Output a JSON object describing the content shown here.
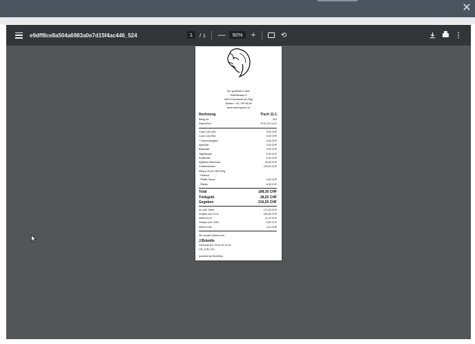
{
  "overlay": {
    "close_icon": "close-icon"
  },
  "toolbar": {
    "title": "e9dff8ce8a504a6983a0e7d15f4ac446_524",
    "page_current": "1",
    "page_separator": "/",
    "page_total": "1",
    "zoom_value": "90%",
    "zoom_out_label": "—",
    "zoom_in_label": "+",
    "icons": [
      "menu-icon",
      "fit-page-icon",
      "rotate-icon",
      "download-icon",
      "print-icon",
      "more-vert-icon"
    ]
  },
  "receipt": {
    "address": [
      "Zur goldenen Löwin",
      "Enfelstrasse 5",
      "6403 Küssnacht am Rigi",
      "Telefon: +41 799 66 60",
      "www.rummywein.ch"
    ],
    "header_left": "Rechnung",
    "header_right": "Tisch 11.1",
    "meta": [
      {
        "label": "Beleg Nr",
        "value": "524"
      },
      {
        "label": "Datum/Zeit",
        "value": "23.01.25 14:31"
      }
    ],
    "items": [
      {
        "label": "Coca Cola 33cl",
        "value": "3,50 CHF"
      },
      {
        "label": "Coca Cola 50cl",
        "value": "4,00 CHF"
      },
      {
        "label": " + Depot Ausgabe",
        "value": "0,50 CHF"
      },
      {
        "label": "Apfelsaft",
        "value": "2,00 CHF"
      },
      {
        "label": "Blattsalat",
        "value": "5,90 CHF"
      },
      {
        "label": "Tagessuppe",
        "value": "5,90 CHF"
      },
      {
        "label": "Kraftbrühe",
        "value": "6,20 CHF"
      },
      {
        "label": "Egli­filets Müllerinart",
        "value": "32,50 CHF"
      },
      {
        "label": "Chateaubriand",
        "value": "120,00 CHF"
      },
      {
        "label": "  500g  à  24,00 CHF/100g",
        "value": ""
      },
      {
        "label": " - Ketchup",
        "value": ""
      },
      {
        "label": " - Pfeffer Sauce",
        "value": "2,50 CHF"
      },
      {
        "label": " - Risotto",
        "value": "6,00 CHF"
      }
    ],
    "totals": [
      {
        "label": "Total",
        "value": "188,30 CHF"
      },
      {
        "label": "Trinkgeld",
        "value": "28,25 CHF"
      },
      {
        "label": "Gegeben",
        "value": "216,55 CHF"
      }
    ],
    "tax": [
      {
        "label": "Zu zahl. Netto",
        "value": "174,40 CHF"
      },
      {
        "label": "Umsatz inkl. 8.1%",
        "value": "182,80 CHF"
      },
      {
        "label": "MWSt 8.1%",
        "value": "13,70 CHF"
      },
      {
        "label": "Umsatz inkl. 3.8%",
        "value": "5,50 CHF"
      },
      {
        "label": "MWSt 3.8%",
        "value": "0,20 CHF"
      }
    ],
    "served_by_label": "Sie wurden bedient von",
    "waiter": "J.Brändle",
    "printed": "Gedruckt am: 23.01.25 14:31",
    "code": "LSt_TuM_Hco",
    "powered": "powered by WorldSys"
  }
}
